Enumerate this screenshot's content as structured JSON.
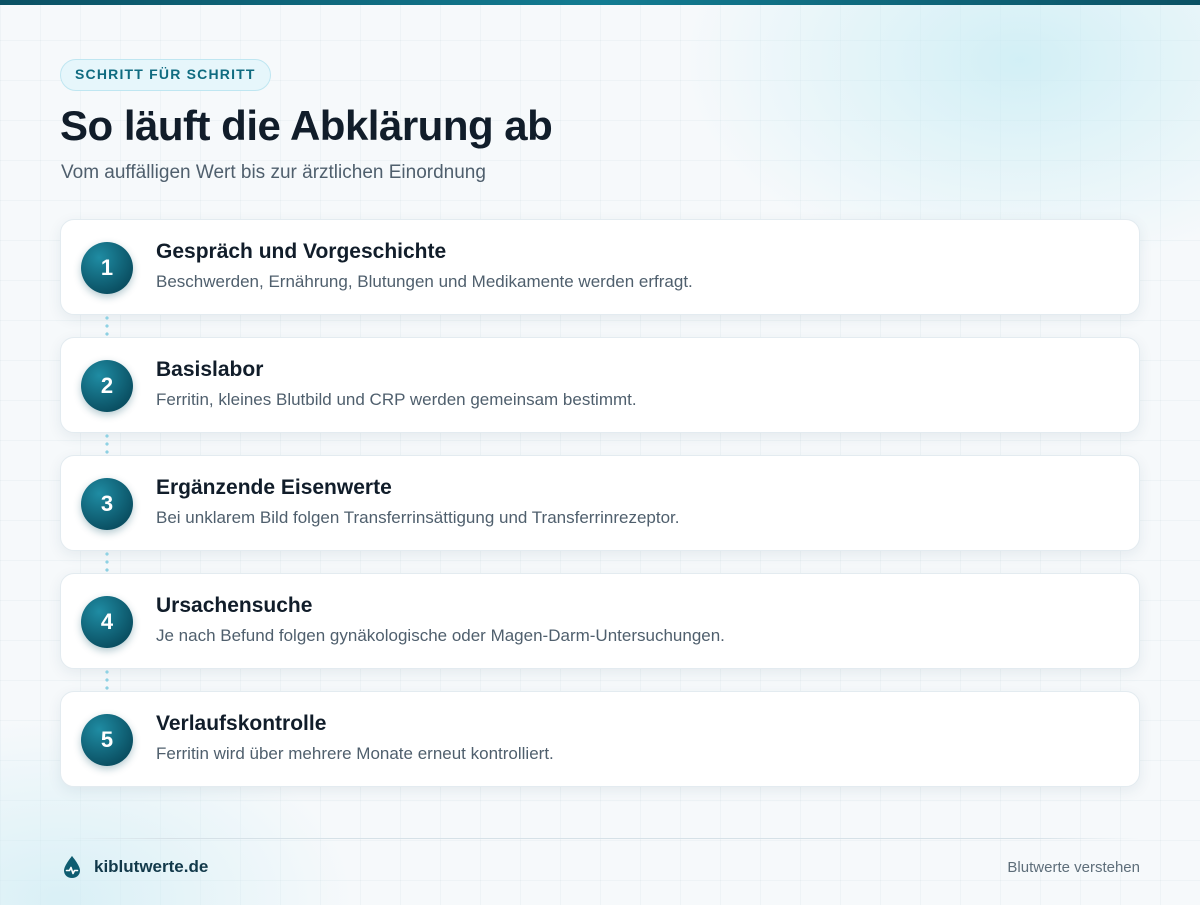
{
  "header": {
    "eyebrow": "SCHRITT FÜR SCHRITT",
    "title": "So läuft die Abklärung ab",
    "subtitle": "Vom auffälligen Wert bis zur ärztlichen Einordnung"
  },
  "steps": [
    {
      "number": "1",
      "title": "Gespräch und Vorgeschichte",
      "description": "Beschwerden, Ernährung, Blutungen und Medikamente werden erfragt."
    },
    {
      "number": "2",
      "title": "Basislabor",
      "description": "Ferritin, kleines Blutbild und CRP werden gemeinsam bestimmt."
    },
    {
      "number": "3",
      "title": "Ergänzende Eisenwerte",
      "description": "Bei unklarem Bild folgen Transferrinsättigung und Transferrinrezeptor."
    },
    {
      "number": "4",
      "title": "Ursachensuche",
      "description": "Je nach Befund folgen gynäkologische oder Magen-Darm-Untersuchungen."
    },
    {
      "number": "5",
      "title": "Verlaufskontrolle",
      "description": "Ferritin wird über mehrere Monate erneut kontrolliert."
    }
  ],
  "footer": {
    "brand": "kiblutwerte.de",
    "brand_icon": "blood-drop-icon",
    "tagline": "Blutwerte verstehen"
  },
  "colors": {
    "accent": "#0f6b80",
    "accent_dark": "#0a4f62",
    "connector": "#8fd2e4"
  }
}
